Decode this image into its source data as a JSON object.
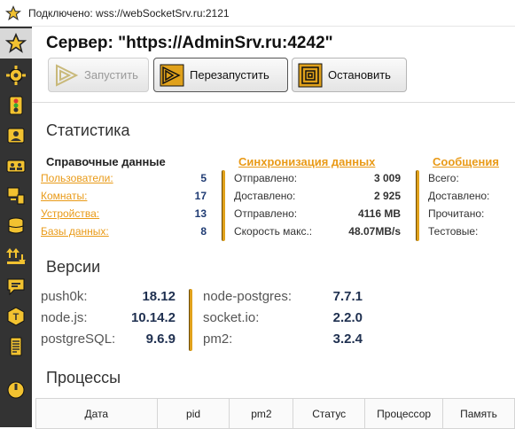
{
  "window": {
    "title": "Подключено: wss://webSocketSrv.ru:2121"
  },
  "sidebar": {
    "items": [
      {
        "icon": "star-icon",
        "active": true
      },
      {
        "icon": "gear-icon"
      },
      {
        "icon": "traffic-light-icon"
      },
      {
        "icon": "user-card-icon"
      },
      {
        "icon": "group-icon"
      },
      {
        "icon": "devices-icon"
      },
      {
        "icon": "database-icon"
      },
      {
        "icon": "sync-arrows-icon"
      },
      {
        "icon": "chat-icon"
      },
      {
        "icon": "template-icon"
      },
      {
        "icon": "log-icon"
      },
      {
        "icon": "power-icon"
      }
    ]
  },
  "header": {
    "server_title": "Сервер: \"https://AdminSrv.ru:4242\""
  },
  "toolbar": {
    "start_label": "Запустить",
    "restart_label": "Перезапустить",
    "stop_label": "Остановить"
  },
  "stats": {
    "title": "Статистика",
    "reference": {
      "heading": "Справочные данные",
      "rows": [
        {
          "label": "Пользователи:",
          "value": "5"
        },
        {
          "label": "Комнаты:",
          "value": "17"
        },
        {
          "label": "Устройства:",
          "value": "13"
        },
        {
          "label": "Базы данных:",
          "value": "8"
        }
      ]
    },
    "sync": {
      "heading": "Синхронизация данных",
      "rows": [
        {
          "label": "Отправлено:",
          "value": "3 009"
        },
        {
          "label": "Доставлено:",
          "value": "2 925"
        },
        {
          "label": "Отправлено:",
          "value": "4116 MB"
        },
        {
          "label": "Скорость макс.:",
          "value": "48.07MB/s"
        }
      ]
    },
    "messages": {
      "heading": "Сообщения",
      "rows": [
        {
          "label": "Всего:"
        },
        {
          "label": "Доставлено:"
        },
        {
          "label": "Прочитано:"
        },
        {
          "label": "Тестовые:"
        }
      ]
    }
  },
  "versions": {
    "title": "Версии",
    "left": [
      {
        "label": "push0k:",
        "value": "18.12"
      },
      {
        "label": "node.js:",
        "value": "10.14.2"
      },
      {
        "label": "postgreSQL:",
        "value": "9.6.9"
      }
    ],
    "right": [
      {
        "label": "node-postgres:",
        "value": "7.7.1"
      },
      {
        "label": "socket.io:",
        "value": "2.2.0"
      },
      {
        "label": "pm2:",
        "value": "3.2.4"
      }
    ]
  },
  "processes": {
    "title": "Процессы",
    "columns": [
      "Дата",
      "pid",
      "pm2",
      "Статус",
      "Процессор",
      "Память"
    ]
  },
  "colors": {
    "accent": "#e99a17",
    "sidebar": "#333333",
    "value_navy": "#1f3b73"
  }
}
